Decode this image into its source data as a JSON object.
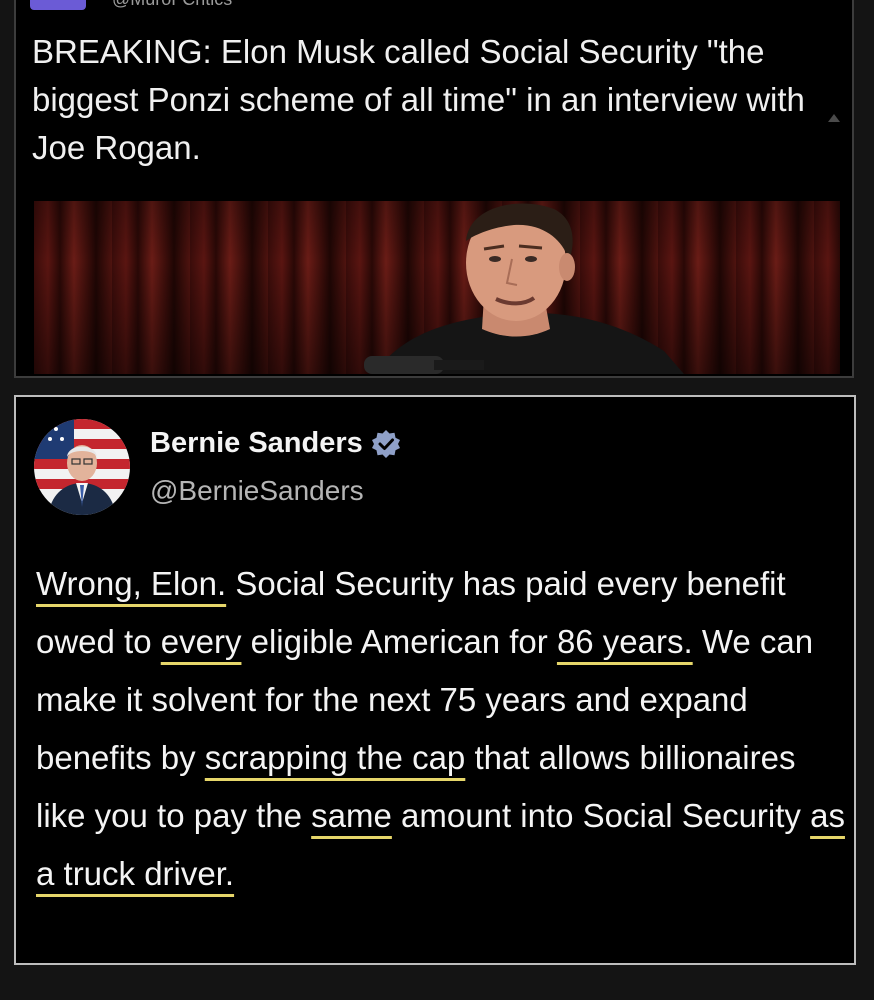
{
  "top_tweet": {
    "handle": "@MuroFCritics",
    "text": "BREAKING: Elon Musk called Social Security \"the biggest Ponzi scheme of all time\" in an interview with Joe Rogan."
  },
  "reply_tweet": {
    "display_name": "Bernie Sanders",
    "handle": "@BernieSanders",
    "verified": true,
    "text_parts": [
      {
        "text": "Wrong, Elon.",
        "highlight": true
      },
      {
        "text": " Social Security has paid every benefit owed to ",
        "highlight": false
      },
      {
        "text": "every",
        "highlight": true
      },
      {
        "text": " eligible American for ",
        "highlight": false
      },
      {
        "text": "86 years.",
        "highlight": true
      },
      {
        "text": " We can make it solvent for the next 75 years and expand benefits by ",
        "highlight": false
      },
      {
        "text": "scrapping the cap",
        "highlight": true
      },
      {
        "text": " that allows billionaires like you to pay the ",
        "highlight": false
      },
      {
        "text": "same",
        "highlight": true
      },
      {
        "text": " amount into Social Security ",
        "highlight": false
      },
      {
        "text": "as a truck driver.",
        "highlight": true
      }
    ]
  },
  "colors": {
    "background": "#141414",
    "card": "#000000",
    "verified_badge": "#8fa0c8",
    "highlight_underline": "#e6d66a",
    "curtain": "#5a1511"
  },
  "icons": {
    "verified": "verified-badge-icon"
  }
}
